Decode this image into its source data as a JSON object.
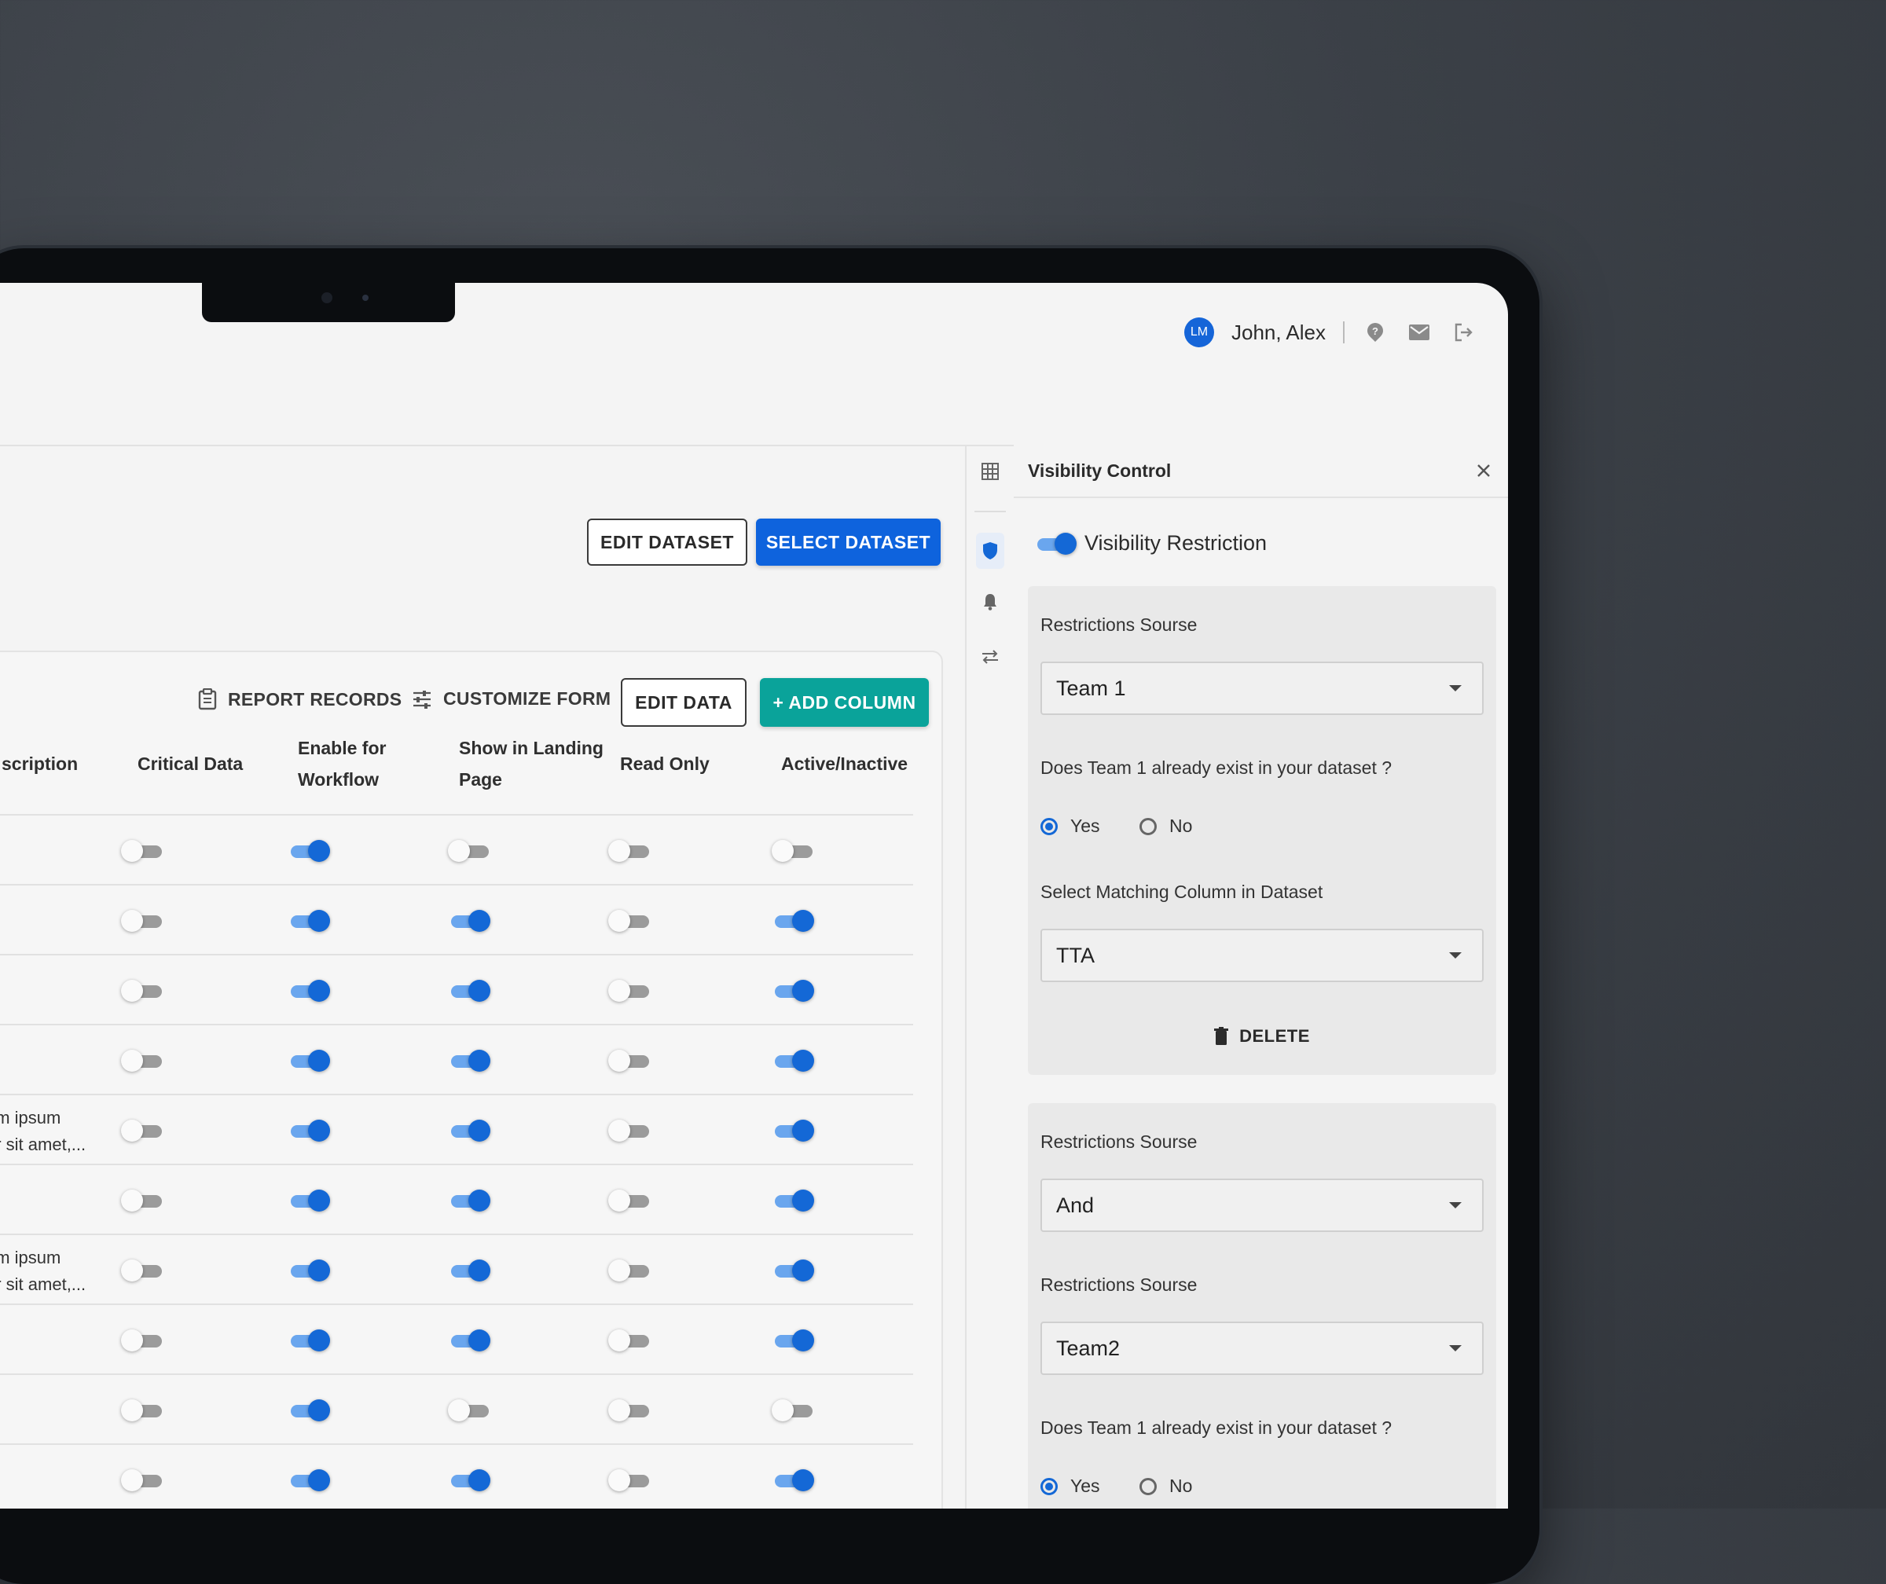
{
  "header": {
    "avatar_initials": "LM",
    "user_name": "John, Alex",
    "icons": [
      "help-icon",
      "mail-icon",
      "logout-icon"
    ]
  },
  "actions": {
    "edit_dataset": "EDIT DATASET",
    "select_dataset": "SELECT DATASET"
  },
  "table_toolbar": {
    "report_records": "REPORT RECORDS",
    "customize_form": "CUSTOMIZE FORM",
    "edit_data": "EDIT DATA",
    "add_column": "+ ADD COLUMN"
  },
  "table": {
    "columns": [
      "scription",
      "Critical Data",
      "Enable for\nWorkflow",
      "Show in Landing\nPage",
      "Read Only",
      "Active/Inactive"
    ],
    "rows": [
      {
        "desc": "",
        "critical": false,
        "workflow": true,
        "landing": false,
        "readonly": false,
        "active": false
      },
      {
        "desc": "",
        "critical": false,
        "workflow": true,
        "landing": true,
        "readonly": false,
        "active": true
      },
      {
        "desc": "",
        "critical": false,
        "workflow": true,
        "landing": true,
        "readonly": false,
        "active": true
      },
      {
        "desc": "",
        "critical": false,
        "workflow": true,
        "landing": true,
        "readonly": false,
        "active": true
      },
      {
        "desc": "em ipsum\nor sit amet,...",
        "critical": false,
        "workflow": true,
        "landing": true,
        "readonly": false,
        "active": true
      },
      {
        "desc": "",
        "critical": false,
        "workflow": true,
        "landing": true,
        "readonly": false,
        "active": true
      },
      {
        "desc": "em ipsum\nor sit amet,...",
        "critical": false,
        "workflow": true,
        "landing": true,
        "readonly": false,
        "active": true
      },
      {
        "desc": "",
        "critical": false,
        "workflow": true,
        "landing": true,
        "readonly": false,
        "active": true
      },
      {
        "desc": "",
        "critical": false,
        "workflow": true,
        "landing": false,
        "readonly": false,
        "active": false
      },
      {
        "desc": "",
        "critical": false,
        "workflow": true,
        "landing": true,
        "readonly": false,
        "active": true
      }
    ]
  },
  "rail": {
    "icons": [
      "table-icon",
      "shield-icon",
      "bell-icon",
      "swap-icon"
    ],
    "active": "shield-icon"
  },
  "panel": {
    "title": "Visibility Control",
    "visibility_label": "Visibility Restriction",
    "visibility_on": true,
    "block1": {
      "source_label": "Restrictions Sourse",
      "source_value": "Team 1",
      "question": "Does Team 1 already exist in your dataset ?",
      "yes": "Yes",
      "no": "No",
      "selected": "Yes",
      "match_label": "Select Matching Column in Dataset",
      "match_value": "TTA",
      "delete_label": "DELETE"
    },
    "block2": {
      "source_label": "Restrictions Sourse",
      "source_value": "And",
      "source2_label": "Restrictions Sourse",
      "source2_value": "Team2",
      "question": "Does Team 1 already exist in your dataset ?",
      "yes": "Yes",
      "no": "No",
      "selected": "Yes"
    }
  },
  "colors": {
    "primary": "#0e63dd",
    "teal": "#0aa39a",
    "toggle_on": "#1468d6"
  }
}
